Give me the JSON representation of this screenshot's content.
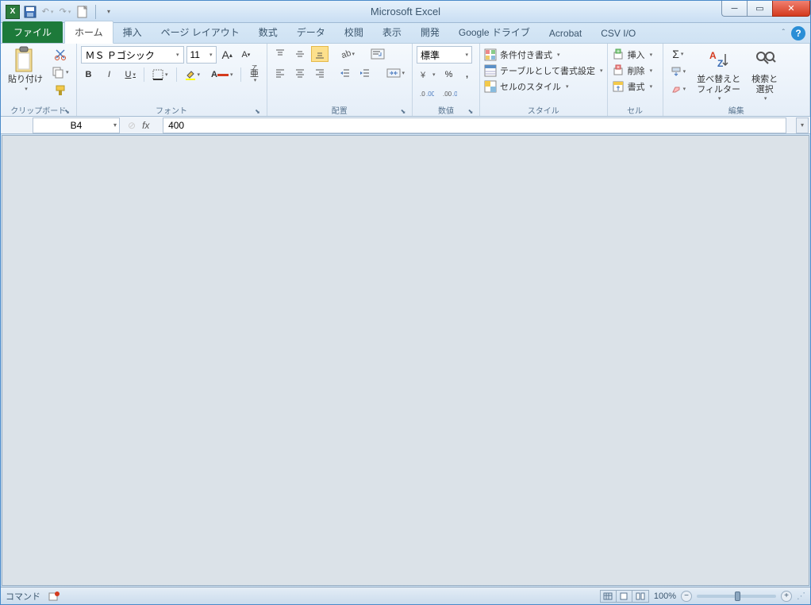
{
  "app": {
    "title": "Microsoft Excel"
  },
  "qat": {
    "undo": "↶",
    "redo": "↷",
    "new": "□"
  },
  "tabs": {
    "file": "ファイル",
    "items": [
      "ホーム",
      "挿入",
      "ページ レイアウト",
      "数式",
      "データ",
      "校閲",
      "表示",
      "開発",
      "Google ドライブ",
      "Acrobat",
      "CSV I/O"
    ],
    "active": 0
  },
  "ribbon": {
    "clipboard": {
      "paste": "貼り付け",
      "label": "クリップボード"
    },
    "font": {
      "name": "ＭＳ Ｐゴシック",
      "size": "11",
      "label": "フォント",
      "boldB": "B",
      "italicI": "I",
      "underlineU": "U",
      "incA": "A",
      "decA": "A",
      "colorA": "A",
      "phoneticA": "ア",
      "phoneticSub": "亜"
    },
    "alignment": {
      "label": "配置"
    },
    "number": {
      "format": "標準",
      "label": "数値",
      "percent": "%",
      "comma": ","
    },
    "styles": {
      "conditional": "条件付き書式",
      "table": "テーブルとして書式設定",
      "cell": "セルのスタイル",
      "label": "スタイル"
    },
    "cells": {
      "insert": "挿入",
      "delete": "削除",
      "format": "書式",
      "label": "セル"
    },
    "editing": {
      "sort": "並べ替えと\nフィルター",
      "find": "検索と\n選択",
      "label": "編集",
      "sigma": "Σ"
    }
  },
  "formula": {
    "cell": "B4",
    "value": "400",
    "fx": "fx"
  },
  "status": {
    "mode": "コマンド",
    "zoom": "100%"
  }
}
